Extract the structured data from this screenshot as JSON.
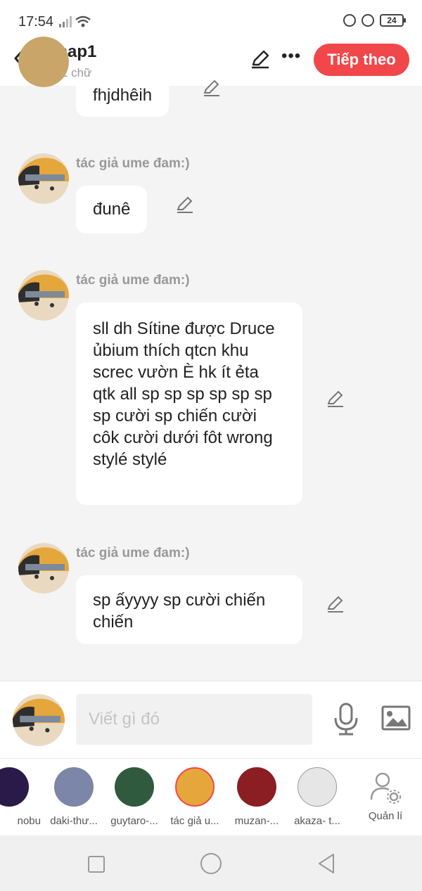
{
  "status_bar": {
    "time": "17:54",
    "battery": "24"
  },
  "header": {
    "title": "chap1",
    "word_count": "312 chữ",
    "next_label": "Tiếp theo"
  },
  "messages": [
    {
      "author": "",
      "text": "fhjdhêih"
    },
    {
      "author": "tác giả ume đam:)",
      "text": "đunê"
    },
    {
      "author": "tác giả ume đam:)",
      "text": "sll dh Sítine được Druce ủbium thích qtcn khu screc vườn È hk ít ẻta qtk all sp sp sp sp sp sp sp cười sp chiến cười côk cười dưới fôt wrong stylé stylé"
    },
    {
      "author": "tác giả ume đam:)",
      "text": "sp ấyyyy sp cười chiến chiến"
    }
  ],
  "compose": {
    "placeholder": "Viết gì đó"
  },
  "characters": [
    {
      "label": "nobu"
    },
    {
      "label": "daki-thư..."
    },
    {
      "label": "guytaro-..."
    },
    {
      "label": "tác giả u..."
    },
    {
      "label": "muzan-..."
    },
    {
      "label": "akaza- t..."
    },
    {
      "label": "Quản lí"
    }
  ],
  "colors": {
    "accent": "#f2474a",
    "background": "#f4f4f4"
  }
}
